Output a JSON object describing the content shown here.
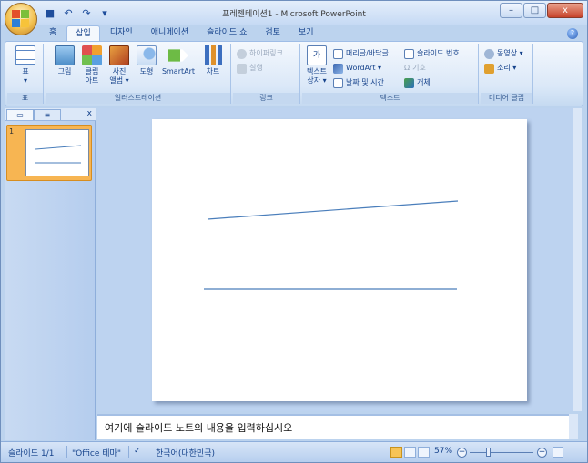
{
  "window": {
    "title": "프레젠테이션1 - Microsoft PowerPoint",
    "controls": {
      "minimize": "–",
      "maximize": "□",
      "close": "x"
    }
  },
  "qat": {
    "save": "■",
    "undo": "↶",
    "redo": "↷",
    "customize": "▾"
  },
  "tabs": [
    {
      "label": "홈"
    },
    {
      "label": "삽입"
    },
    {
      "label": "디자인"
    },
    {
      "label": "애니메이션"
    },
    {
      "label": "슬라이드 쇼"
    },
    {
      "label": "검토"
    },
    {
      "label": "보기"
    }
  ],
  "help": "?",
  "ribbon": {
    "groups": {
      "table": {
        "label": "표",
        "button": "표"
      },
      "illustrations": {
        "label": "일러스트레이션",
        "picture": "그림",
        "clipart_l1": "클립",
        "clipart_l2": "아트",
        "album_l1": "사진",
        "album_l2": "앨범 ▾",
        "shapes": "도형",
        "smartart": "SmartArt",
        "chart": "차트"
      },
      "links": {
        "label": "링크",
        "hyperlink": "하이퍼링크",
        "action": "실행"
      },
      "text": {
        "label": "텍스트",
        "textbox_l1": "텍스트",
        "textbox_l2": "상자 ▾",
        "header_footer": "머리글/바닥글",
        "wordart": "WordArt ▾",
        "datetime": "날짜 및 시간",
        "slide_number": "슬라이드 번호",
        "symbol": "기호",
        "object": "개체"
      },
      "media": {
        "label": "미디어 클립",
        "movie": "동영상 ▾",
        "sound": "소리 ▾"
      }
    }
  },
  "slides_panel": {
    "slide_number": "1",
    "close": "x"
  },
  "notes": {
    "placeholder": "여기에 슬라이드 노트의 내용을 입력하십시오"
  },
  "status": {
    "slide": "슬라이드 1/1",
    "theme": "\"Office 테마\"",
    "language": "한국어(대한민국)",
    "zoom": "57%",
    "zoom_out": "−",
    "zoom_in": "+"
  },
  "colors": {
    "accent": "#4a7ebb",
    "office_orange": "#f2c04e",
    "thumb_selected": "#f7b552"
  }
}
